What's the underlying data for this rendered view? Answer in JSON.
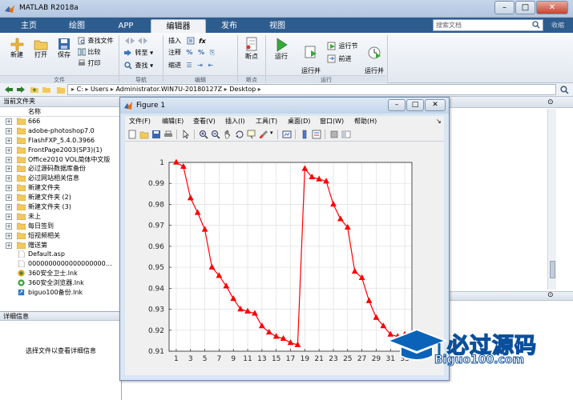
{
  "window": {
    "title": "MATLAB R2018a",
    "controls": [
      "–",
      "□",
      "✕"
    ]
  },
  "tabs": [
    {
      "label": "主页"
    },
    {
      "label": "绘图"
    },
    {
      "label": "APP"
    },
    {
      "label": "编辑器"
    },
    {
      "label": "发布"
    },
    {
      "label": "视图"
    }
  ],
  "search": {
    "placeholder": "搜索文档",
    "collapse_label": "收缩"
  },
  "ribbon": {
    "file": {
      "new": "新建",
      "open": "打开",
      "save": "保存",
      "find_files": "查找文件",
      "compare": "比较",
      "print": "打印",
      "group": "文件"
    },
    "nav": {
      "goto": "转至",
      "find": "查找",
      "group": "导航"
    },
    "edit": {
      "insert": "插入",
      "comment": "注释",
      "indent": "缩进",
      "fx": "fx",
      "group": "编辑"
    },
    "breakpoints": {
      "label": "断点",
      "group": "断点"
    },
    "run": {
      "run": "运行",
      "run_advance": "运行并\n前进",
      "run_section": "运行节",
      "advance": "前进",
      "run_time": "运行并\n计时",
      "group": "运行"
    }
  },
  "address": {
    "parts": [
      "C:",
      "Users",
      "Administrator.WIN7U-20180127Z",
      "Desktop"
    ]
  },
  "file_browser": {
    "title": "当前文件夹",
    "column": "名称",
    "items": [
      {
        "name": "666",
        "type": "folder"
      },
      {
        "name": "adobe-photoshop7.0",
        "type": "folder"
      },
      {
        "name": "FlashFXP_5.4.0.3966",
        "type": "folder"
      },
      {
        "name": "FrontPage2003(SP3)(1)",
        "type": "folder"
      },
      {
        "name": "Office2010 VOL简体中文版",
        "type": "folder"
      },
      {
        "name": "必过源码数据库备份",
        "type": "folder"
      },
      {
        "name": "必过网站相关信息",
        "type": "folder"
      },
      {
        "name": "新建文件夹",
        "type": "folder"
      },
      {
        "name": "新建文件夹 (2)",
        "type": "folder"
      },
      {
        "name": "新建文件夹 (3)",
        "type": "folder"
      },
      {
        "name": "未上",
        "type": "folder"
      },
      {
        "name": "每日签到",
        "type": "folder"
      },
      {
        "name": "短视频相关",
        "type": "folder"
      },
      {
        "name": "赠送第",
        "type": "folder"
      },
      {
        "name": "Default.asp",
        "type": "file"
      },
      {
        "name": "0000000000000000000…",
        "type": "file"
      },
      {
        "name": "360安全卫士.lnk",
        "type": "lnk360"
      },
      {
        "name": "360安全浏览器.lnk",
        "type": "lnkbrowser"
      },
      {
        "name": "biguo100备份.lnk",
        "type": "lnk"
      }
    ],
    "details_title": "详细信息",
    "details_message": "选择文件以查看详细信息"
  },
  "figure": {
    "title": "Figure 1",
    "menu": [
      "文件(F)",
      "编辑(E)",
      "查看(V)",
      "插入(I)",
      "工具(T)",
      "桌面(D)",
      "窗口(W)",
      "帮助(H)"
    ]
  },
  "chart_data": {
    "type": "line",
    "title": "",
    "xlabel": "",
    "ylabel": "",
    "x": [
      1,
      2,
      3,
      4,
      5,
      6,
      7,
      8,
      9,
      10,
      11,
      12,
      13,
      14,
      15,
      16,
      17,
      18,
      19,
      20,
      21,
      22,
      23,
      24,
      25,
      26,
      27,
      28,
      29,
      30,
      31,
      32,
      33,
      34
    ],
    "series": [
      {
        "color": "#ff0000",
        "marker": "triangle",
        "values": [
          1.0,
          0.998,
          0.983,
          0.976,
          0.968,
          0.95,
          0.946,
          0.941,
          0.935,
          0.93,
          0.929,
          0.928,
          0.922,
          0.919,
          0.917,
          0.916,
          0.914,
          0.913,
          0.997,
          0.993,
          0.992,
          0.991,
          0.98,
          0.973,
          0.969,
          0.948,
          0.945,
          0.934,
          0.926,
          0.922,
          0.918,
          0.917,
          0.918,
          0.917
        ]
      }
    ],
    "xlim": [
      0,
      34
    ],
    "ylim": [
      0.91,
      1.0
    ],
    "xticks": [
      1,
      3,
      5,
      7,
      9,
      11,
      13,
      15,
      17,
      19,
      21,
      23,
      25,
      27,
      29,
      31,
      33
    ],
    "yticks": [
      0.91,
      0.92,
      0.93,
      0.94,
      0.95,
      0.96,
      0.97,
      0.98,
      0.99,
      1.0
    ],
    "ytick_labels": [
      "0.91",
      "0.92",
      "0.93",
      "0.94",
      "0.95",
      "0.96",
      "0.97",
      "0.98",
      "0.99",
      "1"
    ],
    "grid": true
  },
  "watermark": {
    "text": "必过源码",
    "url": "Biguo100.com"
  },
  "colors": {
    "tabstrip": "#2d5c8f",
    "accent": "#ff0000",
    "watermark": "#0a4f9b"
  }
}
